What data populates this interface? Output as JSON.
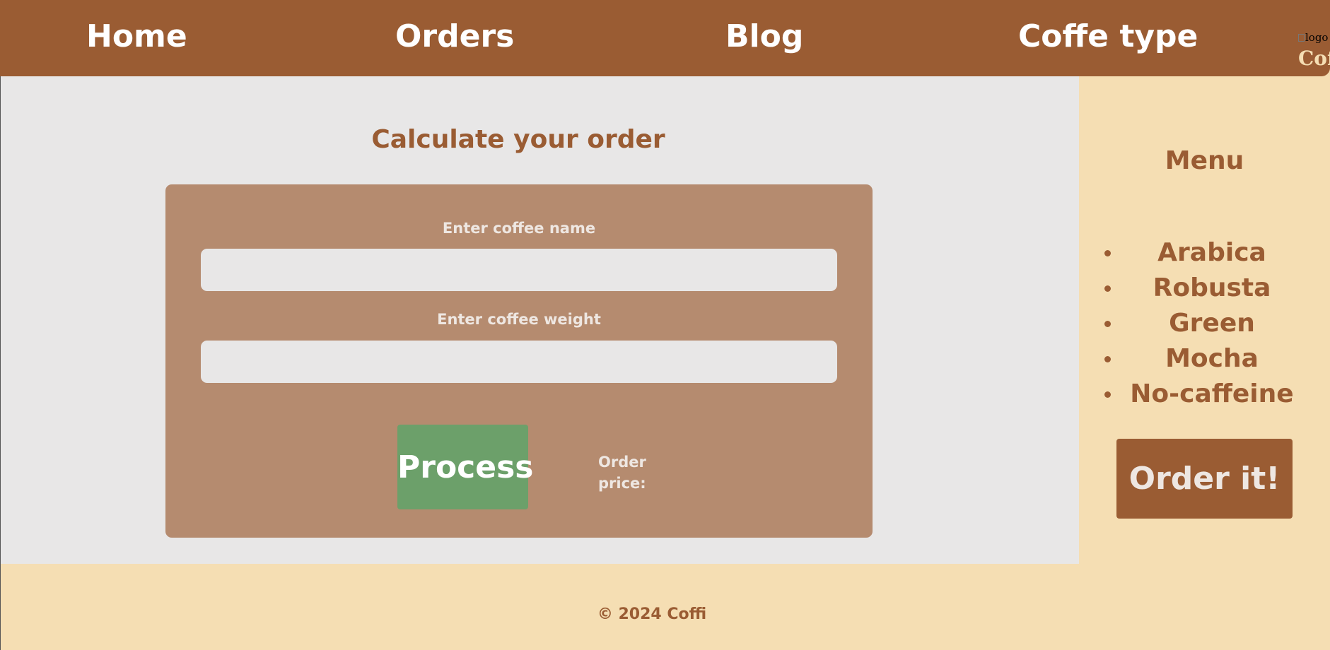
{
  "header": {
    "nav": [
      {
        "label": "Home"
      },
      {
        "label": "Orders"
      },
      {
        "label": "Blog"
      },
      {
        "label": "Coffe type"
      }
    ],
    "logo_alt": "logo",
    "logo_brand": "Coffi"
  },
  "main": {
    "title": "Calculate your order",
    "form": {
      "name_label": "Enter coffee name",
      "name_value": "",
      "weight_label": "Enter coffee weight",
      "weight_value": "",
      "process_label": "Process",
      "price_label": "Order price:"
    }
  },
  "sidebar": {
    "title": "Menu",
    "items": [
      {
        "label": "Arabica"
      },
      {
        "label": "Robusta"
      },
      {
        "label": "Green"
      },
      {
        "label": "Mocha"
      },
      {
        "label": "No-caffeine"
      }
    ],
    "order_label": "Order it!"
  },
  "footer": {
    "copyright": "© 2024 Coffi"
  },
  "colors": {
    "brand_brown": "#9a5c33",
    "wheat": "#f5deb3",
    "panel_grey": "#e8e7e7",
    "card_tan": "#b58b6f",
    "process_green": "#6ca06a"
  }
}
